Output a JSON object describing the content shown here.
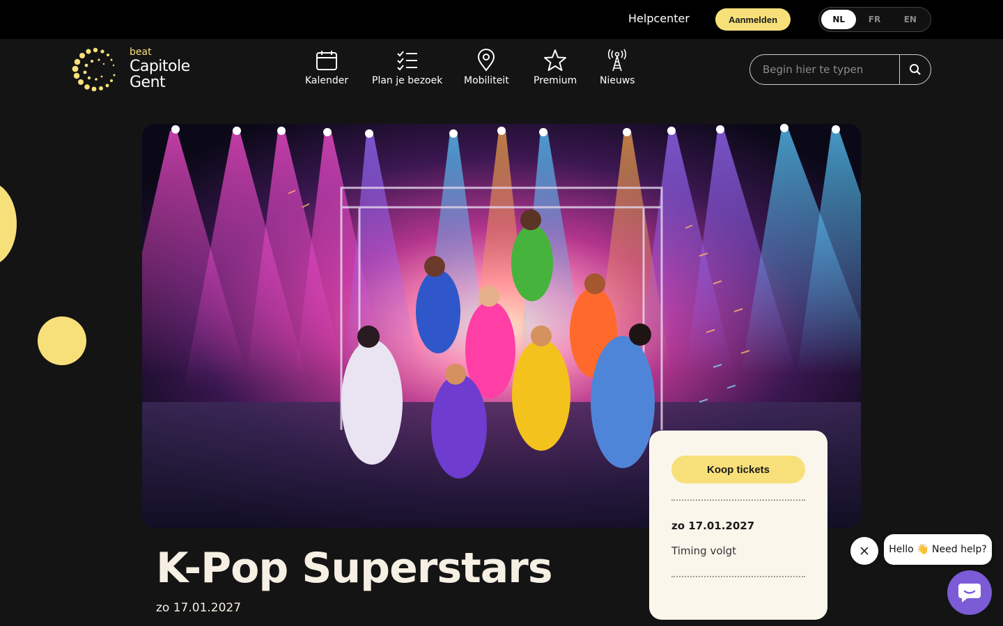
{
  "topbar": {
    "helpcenter": "Helpcenter",
    "login": "Aanmelden",
    "languages": [
      {
        "code": "NL",
        "active": true
      },
      {
        "code": "FR",
        "active": false
      },
      {
        "code": "EN",
        "active": false
      }
    ]
  },
  "logo": {
    "small": "beat",
    "line1": "Capitole",
    "line2": "Gent"
  },
  "nav": [
    {
      "label": "Kalender",
      "icon": "calendar-icon"
    },
    {
      "label": "Plan je bezoek",
      "icon": "checklist-icon"
    },
    {
      "label": "Mobiliteit",
      "icon": "location-pin-icon"
    },
    {
      "label": "Premium",
      "icon": "star-icon"
    },
    {
      "label": "Nieuws",
      "icon": "broadcast-tower-icon"
    }
  ],
  "search": {
    "placeholder": "Begin hier te typen",
    "icon": "search-icon"
  },
  "event": {
    "title": "K-Pop Superstars",
    "date": "zo 17.01.2027"
  },
  "ticket_card": {
    "button": "Koop tickets",
    "date": "zo 17.01.2027",
    "timing": "Timing volgt"
  },
  "chat": {
    "greeting": "Hello 👋 Need help?",
    "close_icon": "close-icon",
    "launcher_icon": "chat-icon"
  },
  "colors": {
    "accent": "#f7e07a",
    "background": "#141414",
    "card": "#fbf6ec",
    "chat": "#7b5bd6"
  }
}
